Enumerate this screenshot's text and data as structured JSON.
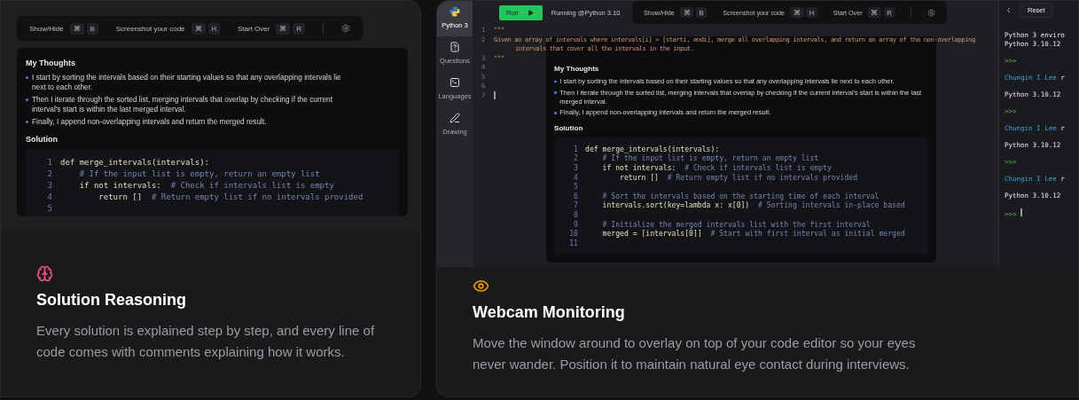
{
  "cards": [
    {
      "kind": "overlay",
      "color": "#f0507a",
      "title": "Solution Reasoning",
      "description": "Every solution is explained step by step, and every line of code comes with comments explaining how it works.",
      "preview": {
        "toolbar": [
          {
            "label": "Show/Hide",
            "keys": [
              "⌘",
              "B"
            ]
          },
          {
            "label": "Screenshot your code",
            "keys": [
              "⌘",
              "H"
            ]
          },
          {
            "label": "Start Over",
            "keys": [
              "⌘",
              "R"
            ]
          }
        ],
        "thoughts_title": "My Thoughts",
        "thoughts": [
          "I start by sorting the intervals based on their starting values so that any overlapping intervals lie next to each other.",
          "Then I iterate through the sorted list, merging intervals that overlap by checking if the current interval's start is within the last merged interval.",
          "Finally, I append non-overlapping intervals and return the merged result."
        ],
        "solution_title": "Solution",
        "code": [
          {
            "number": "1",
            "code": "def merge_intervals(intervals):"
          },
          {
            "number": "2",
            "comment": "    # If the input list is empty, return an empty list"
          },
          {
            "number": "3",
            "code": "    if not intervals:  ",
            "comment": "# Check if intervals list is empty"
          },
          {
            "number": "4",
            "code": "        return []  ",
            "comment": "# Return empty list if no intervals provided"
          },
          {
            "number": "5"
          }
        ]
      }
    },
    {
      "kind": "ide",
      "color": "#f59e0b",
      "title": "Webcam Monitoring",
      "description": "Move the window around to overlay on top of your code editor so your eyes never wander. Position it to maintain natural eye contact during interviews.",
      "preview": {
        "sidebar": [
          {
            "kind": "python",
            "label": "Python 3",
            "selected": true
          },
          {
            "kind": "questions",
            "label": "Questions",
            "selected": false
          },
          {
            "kind": "languages",
            "label": "Languages",
            "selected": false
          },
          {
            "kind": "drawing",
            "label": "Drawing",
            "selected": false
          }
        ],
        "run_label": "Run",
        "status": "Running @Python 3.10",
        "editor": [
          {
            "number": "1",
            "text": "\"\"\"",
            "cursor": false
          },
          {
            "number": "2",
            "text": "Given an array of intervals where intervals[i] = [starti, endi], merge all overlapping intervals, and return an array of the non-overlapping",
            "continuation": "intervals that cover all the intervals in the input.",
            "cursor": false
          },
          {
            "number": "3",
            "text": "\"\"\"",
            "cursor": false
          },
          {
            "number": "4",
            "cursor": false
          },
          {
            "number": "5",
            "cursor": false
          },
          {
            "number": "6",
            "cursor": false
          },
          {
            "number": "7",
            "cursor": true
          }
        ],
        "toolbar": [
          {
            "label": "Show/Hide",
            "keys": [
              "⌘",
              "B"
            ]
          },
          {
            "label": "Screenshot your code",
            "keys": [
              "⌘",
              "H"
            ]
          },
          {
            "label": "Start Over",
            "keys": [
              "⌘",
              "R"
            ]
          }
        ],
        "thoughts_title": "My Thoughts",
        "thoughts": [
          "I start by sorting the intervals based on their starting values so that any overlapping intervals lie next to each other.",
          "Then I iterate through the sorted list, merging intervals that overlap by checking if the current interval's start is within the last merged interval.",
          "Finally, I append non-overlapping intervals and return the merged result."
        ],
        "solution_title": "Solution",
        "code": [
          {
            "number": "1",
            "code": "def merge_intervals(intervals):"
          },
          {
            "number": "2",
            "comment": "    # If the input list is empty, return an empty list"
          },
          {
            "number": "3",
            "code": "    if not intervals:  ",
            "comment": "# Check if intervals list is empty"
          },
          {
            "number": "4",
            "code": "        return []  ",
            "comment": "# Return empty list if no intervals provided"
          },
          {
            "number": "5"
          },
          {
            "number": "6",
            "comment": "    # Sort the intervals based on the starting time of each interval"
          },
          {
            "number": "7",
            "code": "    intervals.sort(key=lambda x: x[0])  ",
            "comment": "# Sorting intervals in-place based"
          },
          {
            "number": "8"
          },
          {
            "number": "9",
            "comment": "    # Initialize the merged intervals list with the first interval"
          },
          {
            "number": "10",
            "code": "    merged = [intervals[0]]  ",
            "comment": "# Start with first interval as initial merged"
          },
          {
            "number": "11"
          }
        ],
        "reset_label": "Reset",
        "terminal": [
          {
            "kind": "output",
            "text": "Python 3 enviro",
            "cursor": false
          },
          {
            "kind": "output",
            "text": "Python 3.10.12",
            "cursor": false
          },
          {
            "kind": "prompt",
            "text": ">>>",
            "cursor": false
          },
          {
            "kind": "user",
            "name": "Chungin I Lee",
            "text": "r",
            "cursor": false
          },
          {
            "kind": "output",
            "text": "Python 3.10.12",
            "cursor": false
          },
          {
            "kind": "prompt",
            "text": ">>>",
            "cursor": false
          },
          {
            "kind": "user",
            "name": "Chungin I Lee",
            "text": "r",
            "cursor": false
          },
          {
            "kind": "output",
            "text": "Python 3.10.12",
            "cursor": false
          },
          {
            "kind": "prompt",
            "text": ">>>",
            "cursor": false
          },
          {
            "kind": "user",
            "name": "Chungin I Lee",
            "text": "r",
            "cursor": false
          },
          {
            "kind": "output",
            "text": "Python 3.10.12",
            "cursor": false
          },
          {
            "kind": "prompt",
            "text": ">>>",
            "cursor": true
          }
        ]
      }
    }
  ]
}
